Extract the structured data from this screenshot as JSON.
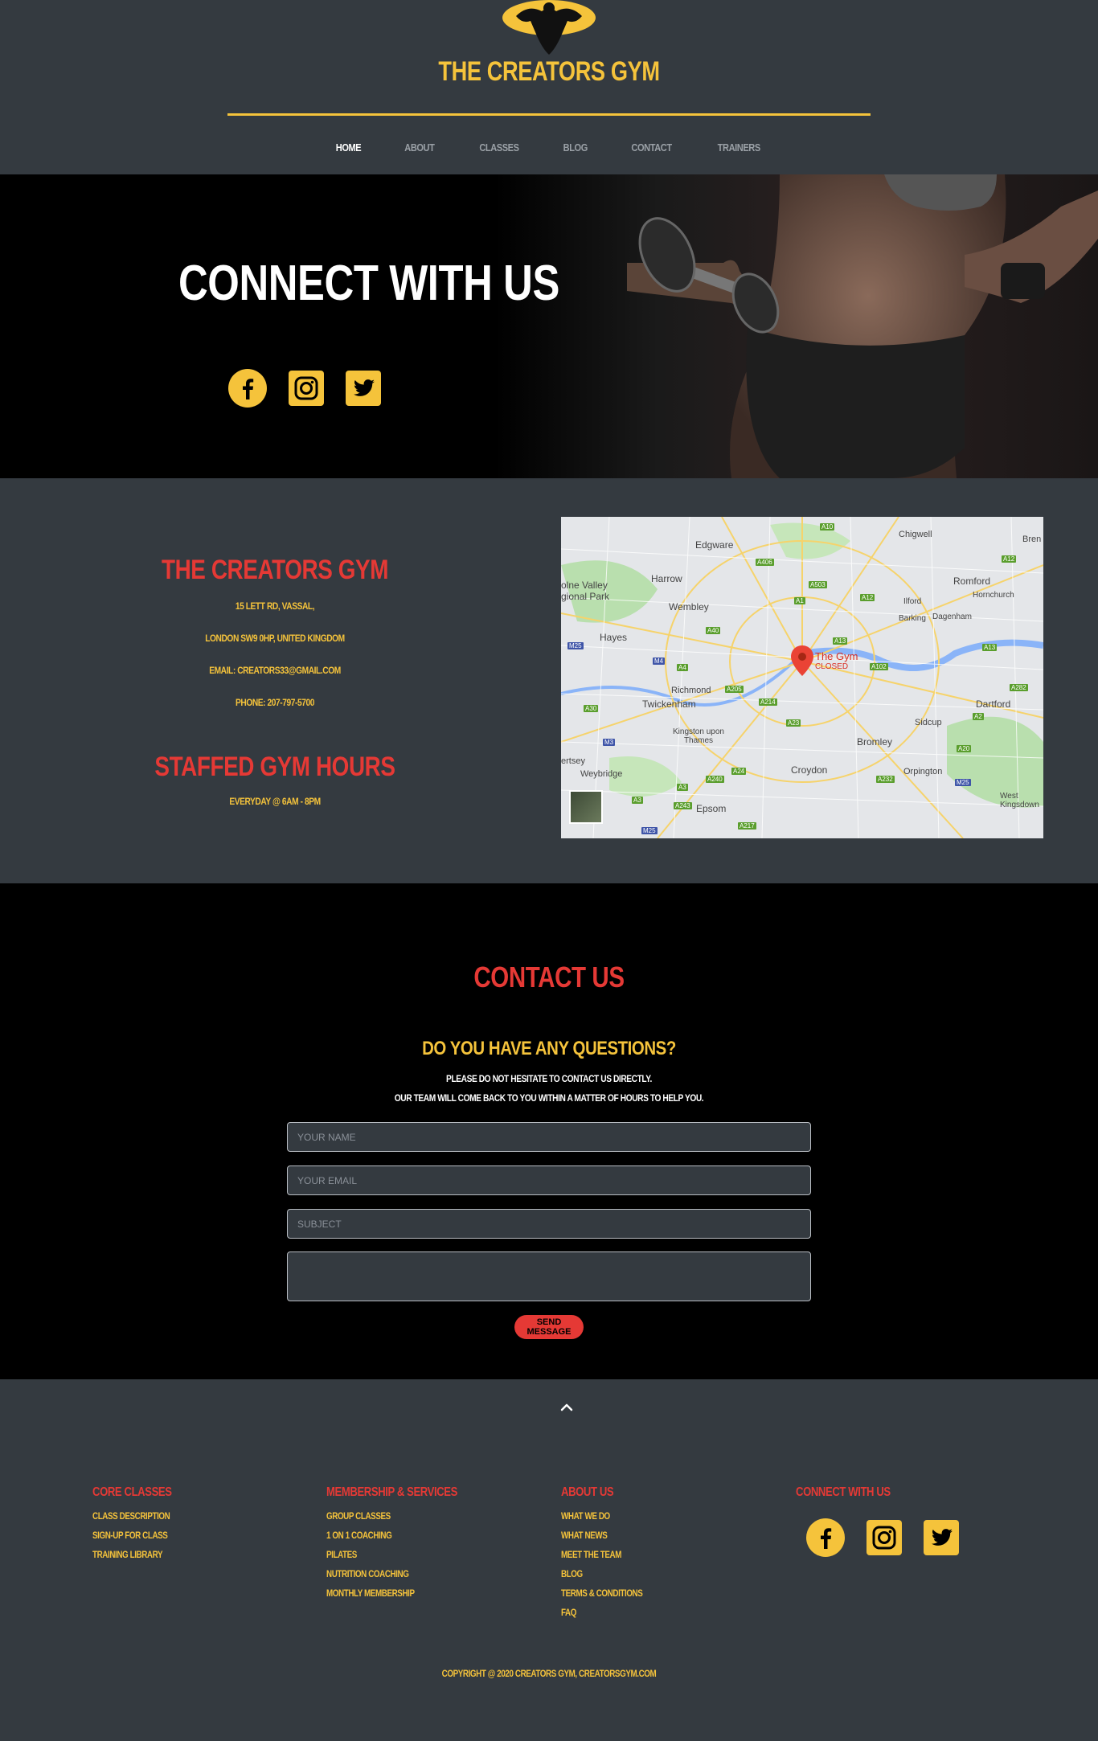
{
  "header": {
    "brand": "THE CREATORS GYM",
    "nav": [
      "HOME",
      "ABOUT",
      "CLASSES",
      "BLOG",
      "CONTACT",
      "TRAINERS"
    ]
  },
  "hero": {
    "title": "CONNECT WITH US"
  },
  "info": {
    "gym_title": "THE CREATORS GYM",
    "address_1": "15 LETT RD, VASSAL,",
    "address_2": "LONDON SW9 0HP, UNITED KINGDOM",
    "email": "EMAIL: CREATORS33@GMAIL.COM",
    "phone": "PHONE: 207-797-5700",
    "hours_title": "STAFFED GYM HOURS",
    "hours": "EVERYDAY @ 6AM - 8PM"
  },
  "map": {
    "places": [
      "Edgware",
      "Chigwell",
      "Harrow",
      "Romford",
      "Hornchurch",
      "Wembley",
      "Ilford",
      "Barking",
      "Dagenham",
      "Hayes",
      "Richmond",
      "Twickenham",
      "Dartford",
      "Sidcup",
      "Kingston upon Thames",
      "Bromley",
      "Croydon",
      "Orpington",
      "Weybridge",
      "Epsom",
      "West Kingsdown",
      "olne Valley",
      "gional Park",
      "ertsey",
      "Bren"
    ],
    "pin_name": "The Gym",
    "pin_status": "CLOSED"
  },
  "contact": {
    "title": "CONTACT US",
    "question": "DO YOU HAVE ANY QUESTIONS?",
    "text_1": "PLEASE DO NOT HESITATE TO CONTACT US DIRECTLY.",
    "text_2": "OUR TEAM WILL COME BACK TO YOU WITHIN A MATTER OF HOURS TO HELP YOU.",
    "name_placeholder": "YOUR NAME",
    "email_placeholder": "YOUR EMAIL",
    "subject_placeholder": "SUBJECT",
    "send_label": "SEND MESSAGE"
  },
  "footer": {
    "col1_title": "CORE CLASSES",
    "col1_links": [
      "CLASS DESCRIPTION",
      "SIGN-UP FOR CLASS",
      "TRAINING LIBRARY"
    ],
    "col2_title": "MEMBERSHIP & SERVICES",
    "col2_links": [
      "GROUP CLASSES",
      "1 ON 1 COACHING",
      "PILATES",
      "NUTRITION COACHING",
      "MONTHLY MEMBERSHIP"
    ],
    "col3_title": "ABOUT US",
    "col3_links": [
      "WHAT WE DO",
      "WHAT NEWS",
      "MEET THE TEAM",
      "BLOG",
      "TERMS & CONDITIONS",
      "FAQ"
    ],
    "col4_title": "CONNECT WITH US",
    "copyright": "COPYRIGHT @ 2020 CREATORS GYM, CREATORSGYM.COM"
  },
  "colors": {
    "accent_yellow": "#f5c33b",
    "accent_red": "#e53935",
    "bg_dark": "#343a40"
  },
  "icons": [
    "facebook-icon",
    "instagram-icon",
    "twitter-icon",
    "chevron-up-icon",
    "map-pin-icon",
    "bodybuilder-logo"
  ]
}
